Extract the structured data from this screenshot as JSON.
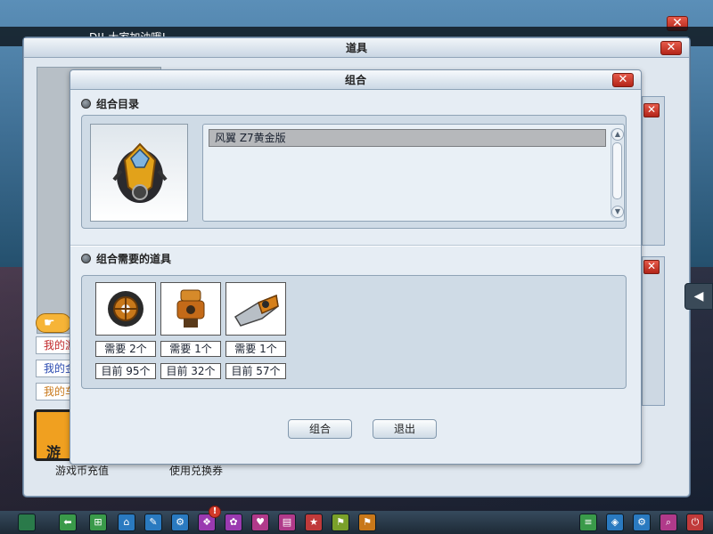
{
  "background": {
    "chat_message": "DJ! 大家加油哦!",
    "top_close": "✕"
  },
  "outer_window": {
    "title": "道具",
    "close": "✕",
    "side_items": [
      "我的游",
      "我的金",
      "我的车"
    ],
    "hand_button": "☛",
    "game_tile_label": "游",
    "bottom_links": [
      "游戏币充值",
      "使用兑换券"
    ]
  },
  "dialog": {
    "title": "组合",
    "close": "✕",
    "section1_title": "组合目录",
    "catalog_items": [
      "风翼 Z7黄金版"
    ],
    "section2_title": "组合需要的道具",
    "requirements": [
      {
        "icon": "wheel-icon",
        "need": "需要 2个",
        "have": "目前 95个"
      },
      {
        "icon": "engine-icon",
        "need": "需要 1个",
        "have": "目前 32个"
      },
      {
        "icon": "exhaust-icon",
        "need": "需要 1个",
        "have": "目前 57个"
      }
    ],
    "buttons": {
      "combine": "组合",
      "exit": "退出"
    }
  },
  "colors": {
    "accent_red": "#d23a2a",
    "frame_bg": "#cfdbe6",
    "selected_row": "#b6b8bb"
  },
  "taskbar": {
    "left_icons": [
      "back-icon",
      "cart-icon",
      "home-icon",
      "wrench-icon",
      "gear-icon",
      "gift-icon",
      "dance-icon",
      "heart-icon",
      "book-icon",
      "stars-icon",
      "flag-icon",
      "flag-icon"
    ],
    "right_icons": [
      "list-icon",
      "map-icon",
      "settings-icon",
      "search-icon",
      "power-icon"
    ]
  }
}
